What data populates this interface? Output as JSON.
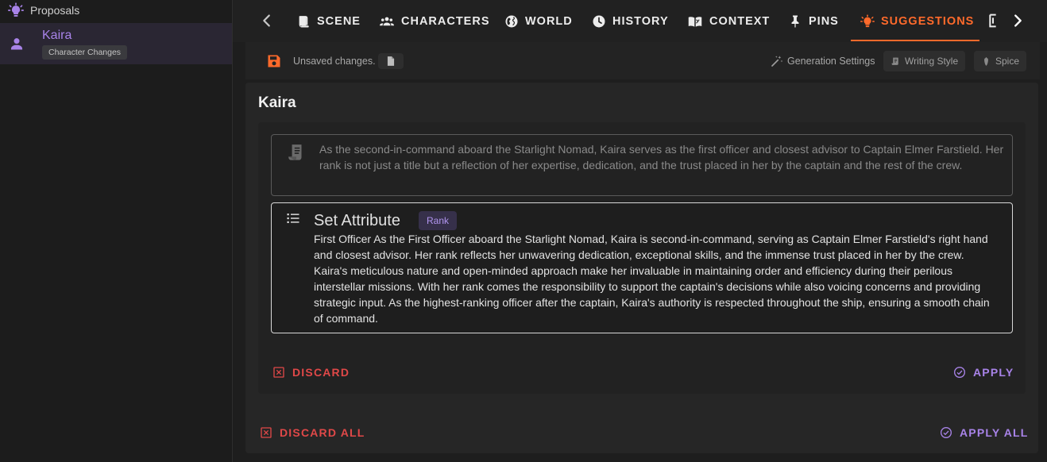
{
  "sidebar": {
    "header_label": "Proposals",
    "items": [
      {
        "name": "Kaira",
        "chip": "Character Changes"
      }
    ]
  },
  "tabs": [
    {
      "label": "SCENE",
      "icon": "scene-icon"
    },
    {
      "label": "CHARACTERS",
      "icon": "characters-icon"
    },
    {
      "label": "WORLD",
      "icon": "world-icon"
    },
    {
      "label": "HISTORY",
      "icon": "history-icon"
    },
    {
      "label": "CONTEXT",
      "icon": "context-icon"
    },
    {
      "label": "PINS",
      "icon": "pin-icon"
    },
    {
      "label": "SUGGESTIONS",
      "icon": "lightbulb-icon",
      "active": true
    }
  ],
  "toolbar": {
    "unsaved_text": "Unsaved changes.",
    "generation_settings": "Generation Settings",
    "writing_style": "Writing Style",
    "spice": "Spice"
  },
  "main": {
    "title": "Kaira",
    "original_text": "As the second-in-command aboard the Starlight Nomad, Kaira serves as the first officer and closest advisor to Captain Elmer Farstield. Her rank is not just a title but a reflection of her expertise, dedication, and the trust placed in her by the captain and the rest of the crew.",
    "suggestion": {
      "heading": "Set Attribute",
      "attribute": "Rank",
      "text": "First Officer As the First Officer aboard the Starlight Nomad, Kaira is second-in-command, serving as Captain Elmer Farstield's right hand and closest advisor. Her rank reflects her unwavering dedication, exceptional skills, and the immense trust placed in her by the crew. Kaira's meticulous nature and open-minded approach make her invaluable in maintaining order and efficiency during their perilous interstellar missions. With her rank comes the responsibility to support the captain's decisions while also voicing concerns and providing strategic input. As the highest-ranking officer after the captain, Kaira's authority is respected throughout the ship, ensuring a smooth chain of command."
    },
    "discard_label": "DISCARD",
    "apply_label": "APPLY",
    "discard_all_label": "DISCARD ALL",
    "apply_all_label": "APPLY ALL"
  },
  "colors": {
    "accent_orange": "#ff6a2b",
    "accent_purple": "#a883e8",
    "discard_red": "#e04848"
  }
}
